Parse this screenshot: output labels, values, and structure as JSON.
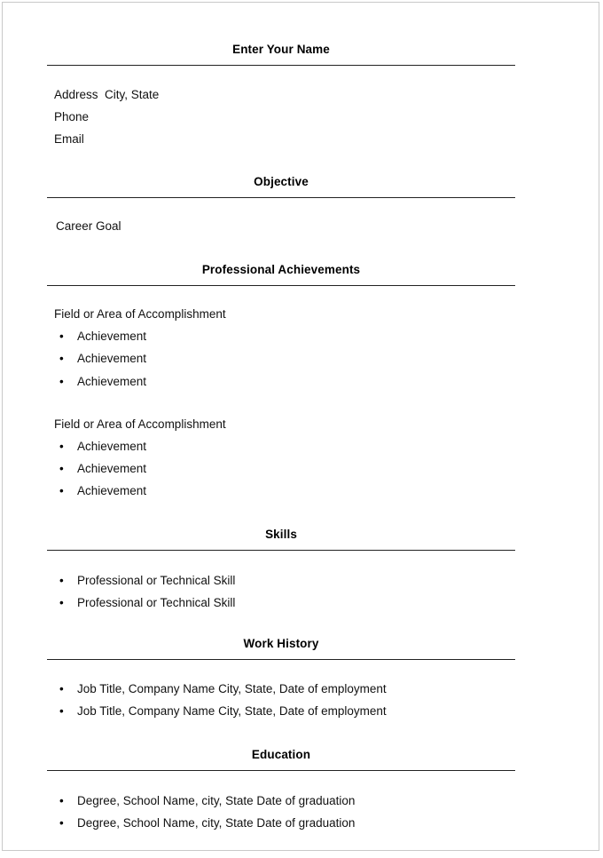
{
  "document": {
    "type": "resume-template",
    "header": {
      "name_placeholder": "Enter Your Name",
      "contact_lines": [
        "Address  City, State",
        "Phone",
        "Email"
      ]
    },
    "sections": [
      {
        "id": "objective",
        "title": "Objective",
        "lines": [
          "Career Goal"
        ]
      },
      {
        "id": "professional-achievements",
        "title": "Professional Achievements",
        "groups": [
          {
            "heading": "Field or Area of Accomplishment",
            "bullets": [
              "Achievement",
              "Achievement",
              "Achievement"
            ]
          },
          {
            "heading": "Field or Area of Accomplishment",
            "bullets": [
              "Achievement",
              "Achievement",
              "Achievement"
            ]
          }
        ]
      },
      {
        "id": "skills",
        "title": "Skills",
        "bullets": [
          "Professional or Technical Skill",
          "Professional or Technical Skill"
        ]
      },
      {
        "id": "work-history",
        "title": "Work History",
        "bullets": [
          "Job Title, Company Name City, State, Date of employment",
          "Job Title, Company Name City, State, Date of employment"
        ]
      },
      {
        "id": "education",
        "title": "Education",
        "bullets": [
          "Degree, School Name, city, State Date of graduation",
          "Degree, School Name, city, State Date of graduation"
        ]
      }
    ],
    "bullet_glyph": "•",
    "colors": {
      "text": "#111111",
      "heading": "#000000",
      "rule": "#232323",
      "page_border": "#c9c9c9",
      "page_background": "#ffffff"
    }
  }
}
